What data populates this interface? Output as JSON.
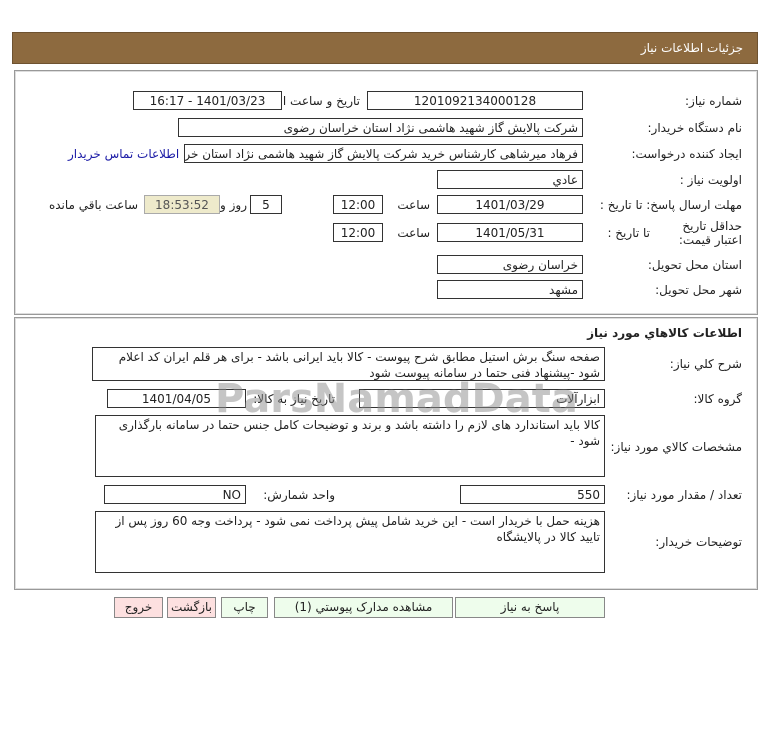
{
  "header": {
    "title": "جزئیات اطلاعات نیاز"
  },
  "info": {
    "need_number_label": "شماره نیاز:",
    "need_number": "1201092134000128",
    "announce_label": "تاریخ و ساعت اعلان عمومی:",
    "announce_value": "1401/03/23 - 16:17",
    "buyer_org_label": "نام دستگاه خریدار:",
    "buyer_org": "شرکت پالایش گاز شهید هاشمی نژاد   استان خراسان رضوی",
    "creator_label": "ایجاد کننده درخواست:",
    "creator": "فرهاد میرشاهی کارشناس خرید شرکت پالایش گاز شهید هاشمی نژاد   استان خراسان رضوی",
    "contact_link": "اطلاعات تماس خریدار",
    "priority_label": "اولویت نیاز :",
    "priority": "عادي",
    "deadline_label": "مهلت ارسال پاسخ: تا تاریخ :",
    "deadline_date": "1401/03/29",
    "time_label": "ساعت",
    "deadline_time": "12:00",
    "days": "5",
    "days_label": "روز و",
    "remaining": "18:53:52",
    "remaining_label": "ساعت باقي مانده",
    "validity_label": "حداقل تاریخ اعتبار قیمت:",
    "validity_to_label": "تا تاریخ :",
    "validity_date": "1401/05/31",
    "validity_time": "12:00",
    "province_label": "استان محل تحویل:",
    "province": "خراسان رضوی",
    "city_label": "شهر محل تحویل:",
    "city": "مشهد"
  },
  "goods": {
    "title": "اطلاعات کالاهاي مورد نیاز",
    "desc_label": "شرح کلي نیاز:",
    "desc": "صفحه سنگ برش استیل مطابق شرح پیوست - کالا باید ایرانی باشد - برای هر قلم ایران کد اعلام شود -پیشنهاد فنی حتما در سامانه پیوست شود",
    "group_label": "گروه کالا:",
    "group": "ابزارآلات",
    "need_date_label": "تاریخ نیاز به کالا:",
    "need_date": "1401/04/05",
    "specs_label": "مشخصات کالاي مورد نیاز:",
    "specs": "کالا باید استاندارد های لازم را داشته باشد و برند و توضیحات کامل جنس حتما در سامانه بارگذاری شود -",
    "qty_label": "تعداد / مقدار مورد نیاز:",
    "qty": "550",
    "unit_label": "واحد شمارش:",
    "unit": "NO",
    "buyer_notes_label": "توضیحات خریدار:",
    "buyer_notes": "هزینه حمل با خریدار است - این خرید شامل پیش پرداخت نمی شود - پرداخت وجه 60 روز پس از تایید کالا در پالایشگاه"
  },
  "buttons": {
    "reply": "پاسخ به نیاز",
    "attachments": "مشاهده مدارک پیوستي (1)",
    "print": "چاپ",
    "back": "بازگشت",
    "exit": "خروج"
  },
  "watermark": {
    "text": "ParsNamadData"
  },
  "colors": {
    "header": "#8d6a3f",
    "button": "#eefdec",
    "button_red": "#fde0e0",
    "link": "#1a1aa6"
  }
}
